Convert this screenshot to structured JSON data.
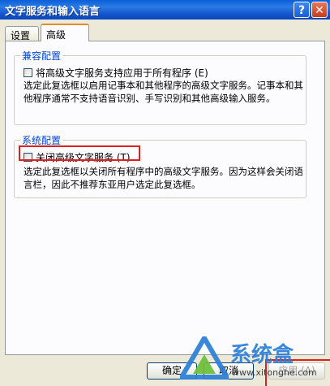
{
  "window": {
    "title": "文字服务和输入语言",
    "help_icon": "?",
    "close_icon": "✕"
  },
  "tabs": [
    {
      "label": "设置"
    },
    {
      "label": "高级"
    }
  ],
  "compat": {
    "group_title": "兼容配置",
    "checkbox_label": "将高级文字服务支持应用于所有程序 (E)",
    "description": "选定此复选框以启用记事本和其他程序的高级文字服务。记事本和其他程序通常不支持语音识别、手写识别和其他高级输入服务。"
  },
  "system": {
    "group_title": "系统配置",
    "checkbox_label": "关闭高级文字服务 (T)",
    "description": "选定此复选框以关闭所有程序中的高级文字服务。因为这样会关闭语言栏，因此不推荐东亚用户选定此复选框。"
  },
  "buttons": {
    "ok": "确定",
    "cancel": "取消",
    "apply": "应用 (A)"
  },
  "watermark": {
    "brand": "系统盒",
    "url": "www.xitonghe.com"
  },
  "colors": {
    "titlebar": "#0a5fd8",
    "group_title": "#0046d5",
    "highlight": "#e0201f"
  }
}
